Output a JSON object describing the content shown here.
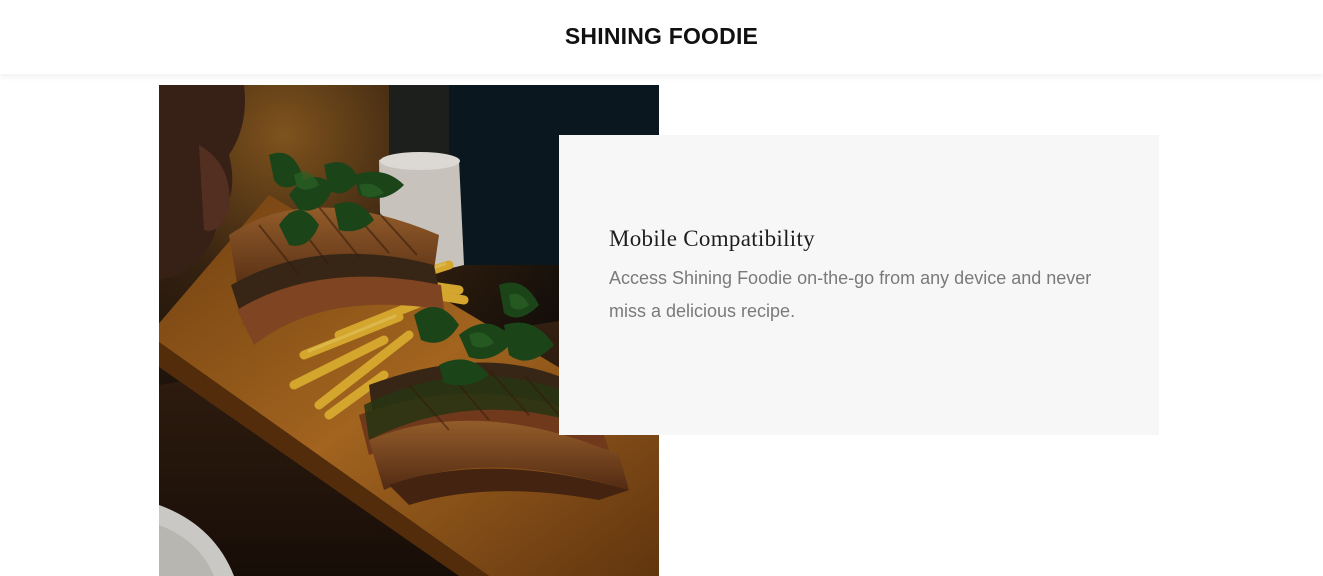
{
  "header": {
    "brand": "SHINING FOODIE"
  },
  "hero_image": {
    "subject": "grilled sandwiches with arugula and french fries on a wooden serving board",
    "colors": {
      "board": "#a8651e",
      "bread": "#8a4a24",
      "greens": "#1f4a1c",
      "fries": "#e6b531",
      "background": "#1c1410"
    }
  },
  "feature": {
    "title": "Mobile Compatibility",
    "description": "Access Shining Foodie on-the-go from any device and never miss a delicious recipe."
  }
}
